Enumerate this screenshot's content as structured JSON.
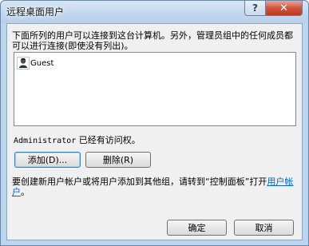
{
  "window": {
    "title": "远程桌面用户",
    "help_button": "?",
    "close_button": "✕"
  },
  "dialog": {
    "description": "下面所列的用户可以连接到这台计算机。另外，管理员组中的任何成员都可以进行连接(即使没有列出)。",
    "users": [
      {
        "label": "Guest",
        "icon": "user-icon"
      }
    ],
    "access_user": "Administrator",
    "access_suffix": " 已经有访问权。",
    "add_button": "添加(D)...",
    "remove_button": "删除(R)",
    "help_prefix": "要创建新用户帐户或将用户添加到其他组，请转到“控制面板”打开",
    "help_link": "用户帐户",
    "help_suffix": "。",
    "ok_button": "确定",
    "cancel_button": "取消"
  },
  "colors": {
    "close_button": "#c0361d",
    "link": "#0066cc",
    "default_button_border": "#3c7fb1"
  }
}
